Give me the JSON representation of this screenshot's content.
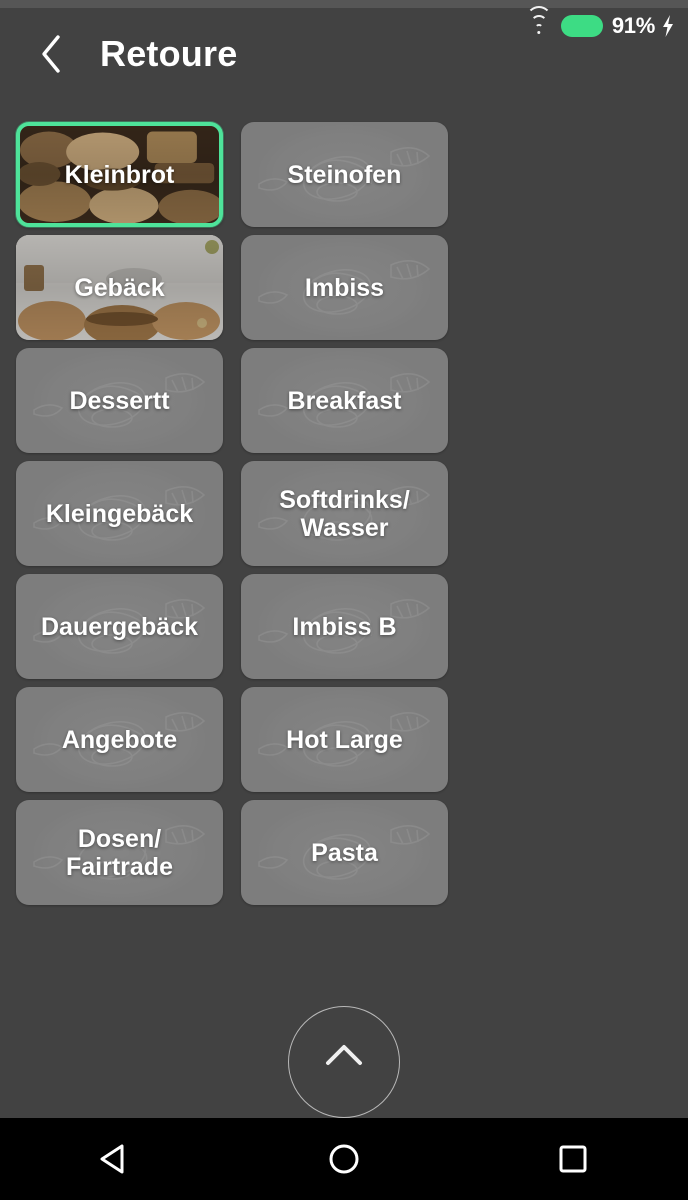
{
  "status_bar": {
    "wifi_icon": "wifi-icon",
    "battery_icon": "battery-full-icon",
    "battery_percent": "91%",
    "charging_icon": "lightning-bolt-icon",
    "battery_color": "#3ddc84"
  },
  "app_bar": {
    "back_icon": "chevron-left-icon",
    "title": "Retoure"
  },
  "theme": {
    "page_background": "#424242",
    "status_strip": "#565656",
    "tile_background": "#7d7d7d",
    "selected_border": "#4ee39a",
    "nav_background": "#000000",
    "text_color": "#ffffff"
  },
  "grid": {
    "tiles": [
      {
        "label": "Kleinbrot",
        "selected": true,
        "image": "bread-photo"
      },
      {
        "label": "Steinofen",
        "selected": false,
        "image": null
      },
      {
        "label": "Gebäck",
        "selected": false,
        "image": "cookies-photo"
      },
      {
        "label": "Imbiss",
        "selected": false,
        "image": null
      },
      {
        "label": "Dessertt",
        "selected": false,
        "image": null
      },
      {
        "label": "Breakfast",
        "selected": false,
        "image": null
      },
      {
        "label": "Kleingebäck",
        "selected": false,
        "image": null
      },
      {
        "label": "Softdrinks/\nWasser",
        "selected": false,
        "image": null
      },
      {
        "label": "Dauergebäck",
        "selected": false,
        "image": null
      },
      {
        "label": "Imbiss B",
        "selected": false,
        "image": null
      },
      {
        "label": "Angebote",
        "selected": false,
        "image": null
      },
      {
        "label": "Hot Large",
        "selected": false,
        "image": null
      },
      {
        "label": "Dosen/\nFairtrade",
        "selected": false,
        "image": null
      },
      {
        "label": "Pasta",
        "selected": false,
        "image": null
      }
    ]
  },
  "fab": {
    "icon": "chevron-up-icon"
  },
  "nav_bar": {
    "back_icon": "triangle-back-icon",
    "home_icon": "circle-home-icon",
    "recents_icon": "square-recents-icon"
  }
}
